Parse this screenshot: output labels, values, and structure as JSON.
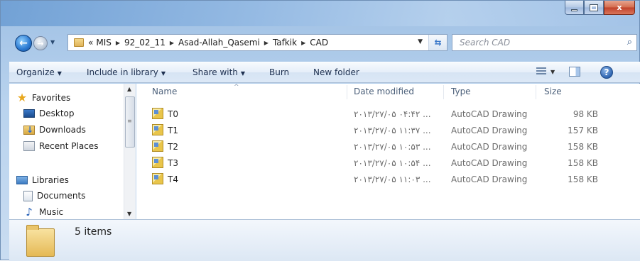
{
  "window": {
    "caption_buttons": {
      "minimize_icon": "minimize-icon",
      "maximize_icon": "maximize-icon",
      "close_label": "x"
    }
  },
  "nav": {
    "back_glyph": "←",
    "forward_glyph": "→",
    "recent_glyph": "▼",
    "breadcrumb": [
      "«",
      "MIS",
      "92_02_11",
      "Asad-Allah_Qasemi",
      "Tafkik",
      "CAD"
    ],
    "address_dropdown_glyph": "▼",
    "refresh_glyph": "⇆"
  },
  "search": {
    "placeholder": "Search CAD",
    "icon": "⌕"
  },
  "toolbar": {
    "organize": "Organize",
    "include_in_library": "Include in library",
    "share_with": "Share with",
    "burn": "Burn",
    "new_folder": "New folder",
    "caret": "▼",
    "help": "?"
  },
  "sidebar": {
    "favorites": "Favorites",
    "desktop": "Desktop",
    "downloads": "Downloads",
    "recent_places": "Recent Places",
    "libraries": "Libraries",
    "documents": "Documents",
    "music": "Music"
  },
  "file_list": {
    "columns": {
      "name": "Name",
      "date": "Date modified",
      "type": "Type",
      "size": "Size"
    },
    "files": [
      {
        "name": "T0",
        "date": "۲۰۱۳/۲۷/۰۵ ۰۴:۴۲ ...",
        "type": "AutoCAD Drawing",
        "size": "98 KB"
      },
      {
        "name": "T1",
        "date": "۲۰۱۳/۲۷/۰۵ ۱۱:۳۷ ...",
        "type": "AutoCAD Drawing",
        "size": "157 KB"
      },
      {
        "name": "T2",
        "date": "۲۰۱۳/۲۷/۰۵ ۱۰:۵۳ ...",
        "type": "AutoCAD Drawing",
        "size": "158 KB"
      },
      {
        "name": "T3",
        "date": "۲۰۱۳/۲۷/۰۵ ۱۰:۵۴ ...",
        "type": "AutoCAD Drawing",
        "size": "158 KB"
      },
      {
        "name": "T4",
        "date": "۲۰۱۳/۲۷/۰۵ ۱۱:۰۳ ...",
        "type": "AutoCAD Drawing",
        "size": "158 KB"
      }
    ]
  },
  "details": {
    "items_count": "5 items"
  }
}
